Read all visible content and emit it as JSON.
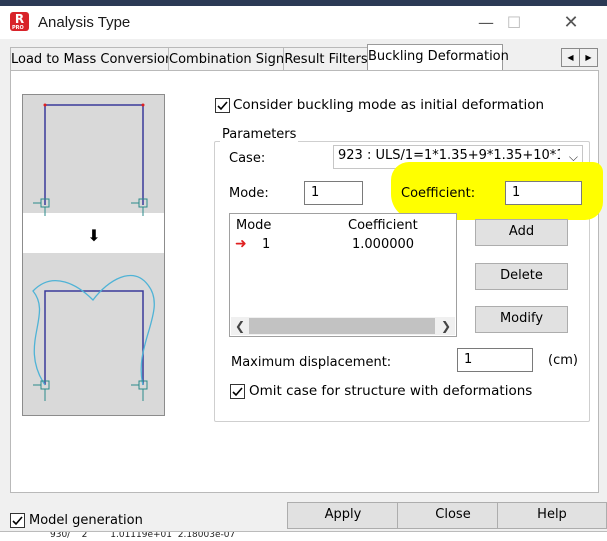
{
  "window": {
    "title": "Analysis Type",
    "app_icon_letter": "R",
    "app_icon_sub": "PRO",
    "minimize_glyph": "—",
    "maximize_glyph": "☐",
    "close_glyph": "✕"
  },
  "tabs": [
    {
      "label": "Load to Mass Conversion"
    },
    {
      "label": "Combination Sign"
    },
    {
      "label": "Result Filters"
    },
    {
      "label": "Buckling Deformation",
      "active": true
    }
  ],
  "tab_scroll": {
    "left": "◀",
    "right": "▶"
  },
  "buckling": {
    "consider_label": "Consider buckling mode as initial deformation",
    "consider_checked": true,
    "params_legend": "Parameters",
    "case_label": "Case:",
    "case_value": "923 : ULS/1=1*1.35+9*1.35+10*1.",
    "mode_label": "Mode:",
    "mode_value": "1",
    "coefficient_label": "Coefficient:",
    "coefficient_value": "1",
    "list": {
      "headers": [
        "Mode",
        "Coefficient"
      ],
      "rows": [
        {
          "mode": "1",
          "coefficient": "1.000000"
        }
      ]
    },
    "add_label": "Add",
    "delete_label": "Delete",
    "modify_label": "Modify",
    "max_disp_label": "Maximum displacement:",
    "max_disp_value": "1",
    "max_disp_unit": "(cm)",
    "omit_label": "Omit case for structure with deformations",
    "omit_checked": true
  },
  "footer": {
    "model_generation_label": "Model generation",
    "model_generation_checked": true,
    "apply_label": "Apply",
    "close_label": "Close",
    "help_label": "Help"
  },
  "colors": {
    "highlight": "#ffff00",
    "frame": "#3a3a9a",
    "buckled_curve": "#4fb3d6",
    "support": "#2a8a8a",
    "current_row_arrow": "#e02020"
  },
  "underlay": {
    "text": "930/    2        1.01119e+01  2.18003e-07"
  }
}
